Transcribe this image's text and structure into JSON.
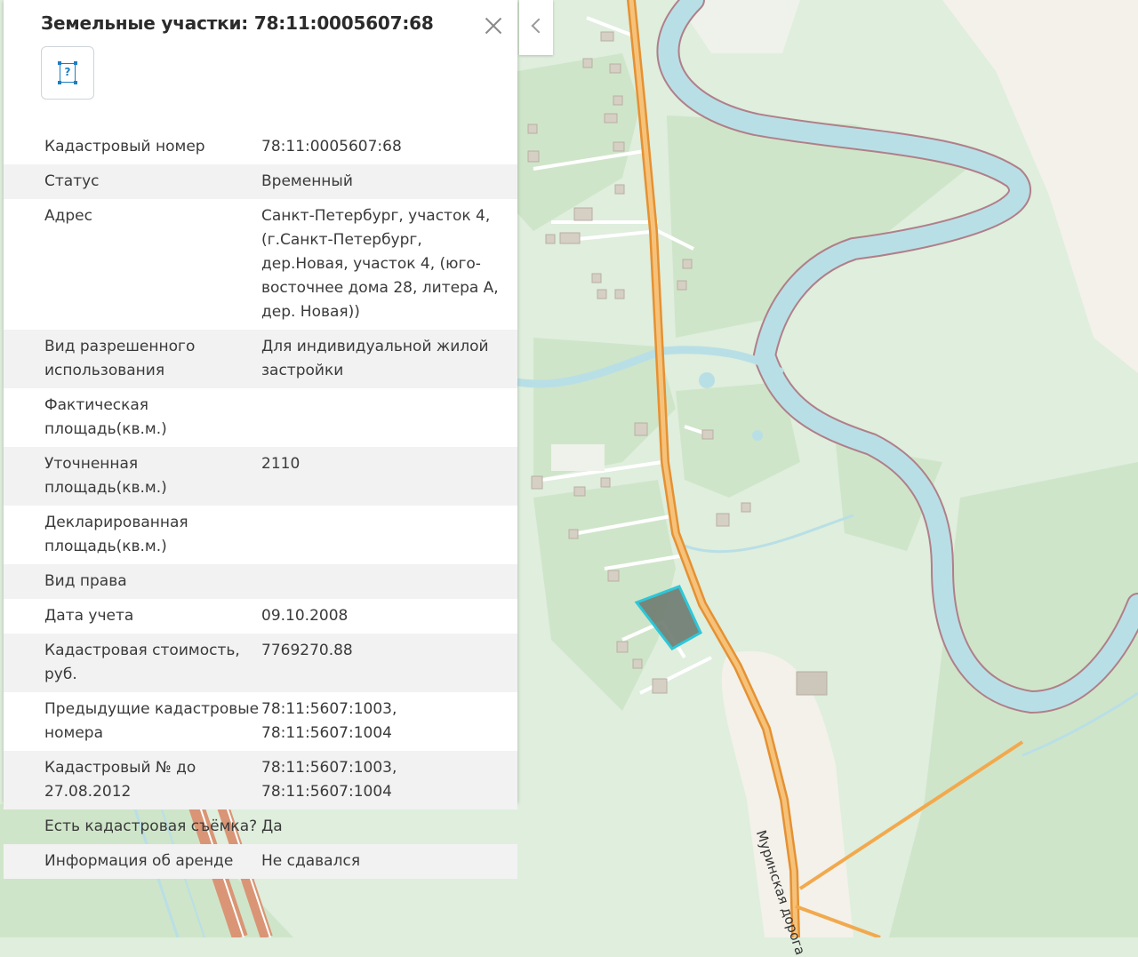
{
  "panel": {
    "title": "Земельные участки: 78:11:0005607:68",
    "close_icon": "close-icon",
    "type_icon": "parcel-icon",
    "type_icon_glyph": "?",
    "rows": [
      {
        "label": "Кадастровый номер",
        "value": "78:11:0005607:68"
      },
      {
        "label": "Статус",
        "value": "Временный"
      },
      {
        "label": "Адрес",
        "value": "Санкт-Петербург, участок 4, (г.Санкт-Петербург, дер.Новая, участок 4, (юго-восточнее дома 28, литера А, дер. Новая))"
      },
      {
        "label": "Вид разрешенного использования",
        "value": "Для индивидуальной жилой застройки"
      },
      {
        "label": "Фактическая площадь(кв.м.)",
        "value": ""
      },
      {
        "label": "Уточненная площадь(кв.м.)",
        "value": "2110"
      },
      {
        "label": "Декларированная площадь(кв.м.)",
        "value": ""
      },
      {
        "label": "Вид права",
        "value": ""
      },
      {
        "label": "Дата учета",
        "value": "09.10.2008"
      },
      {
        "label": "Кадастровая стоимость, руб.",
        "value": "7769270.88"
      },
      {
        "label": "Предыдущие кадастровые номера",
        "value": "78:11:5607:1003, 78:11:5607:1004"
      },
      {
        "label": "Кадастровый № до 27.08.2012",
        "value": "78:11:5607:1003, 78:11:5607:1004"
      },
      {
        "label": "Есть кадастровая съёмка?",
        "value": "Да"
      },
      {
        "label": "Информация об аренде",
        "value": "Не сдавался"
      }
    ]
  },
  "toggle": {
    "icon": "chevron-left-icon"
  },
  "map": {
    "road_label": "Муринская дорога",
    "colors": {
      "forest": "#cfe5c9",
      "open": "#dfeedd",
      "water": "#b9dfe6",
      "river_edge": "#b07f89",
      "road": "#f2a94e",
      "road_outline": "#e59132",
      "parcel_fill": "#6e7a70",
      "parcel_edge": "#2dc7d9",
      "sand": "#f3f1ea"
    }
  }
}
